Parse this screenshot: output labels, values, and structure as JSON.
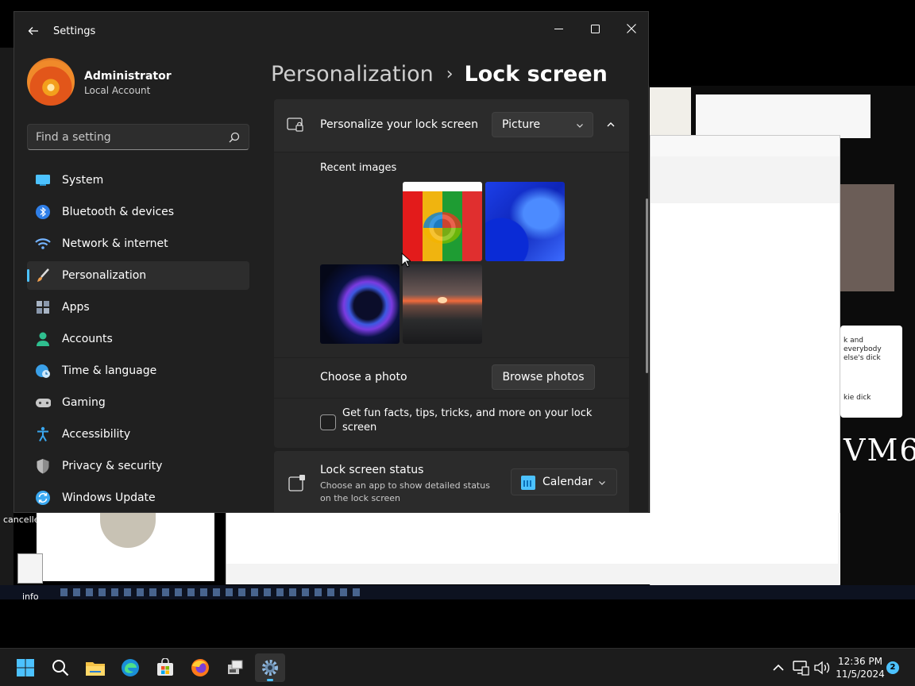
{
  "window": {
    "app_title": "Settings",
    "back_icon": "back-arrow-icon",
    "controls": [
      "minimize-icon",
      "maximize-icon",
      "close-icon"
    ]
  },
  "profile": {
    "name": "Administrator",
    "account_type": "Local Account"
  },
  "search": {
    "placeholder": "Find a setting",
    "value": ""
  },
  "nav": {
    "items": [
      {
        "label": "System",
        "icon": "system-monitor-icon",
        "color": "#4cc2ff"
      },
      {
        "label": "Bluetooth & devices",
        "icon": "bluetooth-icon",
        "color": "#2f7fe8"
      },
      {
        "label": "Network & internet",
        "icon": "wifi-icon",
        "color": "#74b3ff"
      },
      {
        "label": "Personalization",
        "icon": "paintbrush-icon",
        "color": "#f0a050",
        "active": true
      },
      {
        "label": "Apps",
        "icon": "apps-icon",
        "color": "#a8b4c4"
      },
      {
        "label": "Accounts",
        "icon": "person-icon",
        "color": "#2fbf8f"
      },
      {
        "label": "Time & language",
        "icon": "globe-clock-icon",
        "color": "#3aa0e8"
      },
      {
        "label": "Gaming",
        "icon": "gamepad-icon",
        "color": "#c8c8c8"
      },
      {
        "label": "Accessibility",
        "icon": "accessibility-icon",
        "color": "#3aa8f0"
      },
      {
        "label": "Privacy & security",
        "icon": "shield-icon",
        "color": "#9a9a9a"
      },
      {
        "label": "Windows Update",
        "icon": "update-icon",
        "color": "#3aa8f0"
      }
    ]
  },
  "breadcrumb": {
    "parent": "Personalization",
    "separator": "›",
    "current": "Lock screen"
  },
  "lock_screen": {
    "personalize_label": "Personalize your lock screen",
    "personalize_value": "Picture",
    "recent_images_label": "Recent images",
    "recent_images": [
      "windows-logo-image",
      "blue-bloom-image",
      "glow-orb-image",
      "sunset-lake-image"
    ],
    "choose_photo_label": "Choose a photo",
    "browse_button": "Browse photos",
    "fun_facts_label": "Get fun facts, tips, tricks, and more on your lock screen",
    "fun_facts_checked": false,
    "status_title": "Lock screen status",
    "status_description": "Choose an app to show detailed status on the lock screen",
    "status_value": "Calendar"
  },
  "background": {
    "canceled_file": "cancelled.exe",
    "info_file": "info",
    "note_text": "k and everybody else's dick",
    "note_text2": "kie dick",
    "vm_label": "VM6"
  },
  "taskbar": {
    "apps": [
      "start-icon",
      "search-icon",
      "file-explorer-icon",
      "edge-icon",
      "store-icon",
      "firefox-icon",
      "vm-app-icon",
      "settings-icon"
    ],
    "time": "12:36 PM",
    "date": "11/5/2024",
    "notification_count": "2"
  },
  "colors": {
    "accent": "#4cc2ff",
    "window_bg": "#202020",
    "card_bg": "#2b2b2b"
  }
}
